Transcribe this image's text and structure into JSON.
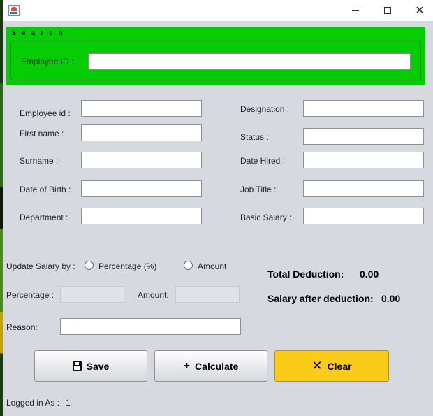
{
  "search": {
    "title": "S e a r c h",
    "employee_id_label": "Employee ID :",
    "employee_id_value": ""
  },
  "form": {
    "employee_id_label": "Employee id :",
    "first_name_label": "First name :",
    "surname_label": "Surname :",
    "dob_label": "Date of Birth :",
    "department_label": "Department :",
    "designation_label": "Designation :",
    "status_label": "Status :",
    "date_hired_label": "Date Hired :",
    "job_title_label": "Job Title :",
    "basic_salary_label": "Basic Salary :"
  },
  "salary": {
    "update_label": "Update Salary by :",
    "percentage_option": "Percentage (%)",
    "amount_option": "Amount",
    "percentage_label": "Percentage :",
    "amount_label": "Amount:",
    "reason_label": "Reason:"
  },
  "summary": {
    "total_deduction_label": "Total Deduction:",
    "total_deduction_value": "0.00",
    "salary_after_label": "Salary after deduction:",
    "salary_after_value": "0.00"
  },
  "buttons": {
    "save": "Save",
    "calculate": "Calculate",
    "clear": "Clear"
  },
  "footer": {
    "logged_in_label": "Logged in As :",
    "logged_in_value": "1"
  },
  "colors": {
    "search_panel": "#06cc06",
    "clear_button": "#fbcc17",
    "background": "#d6d9df"
  }
}
